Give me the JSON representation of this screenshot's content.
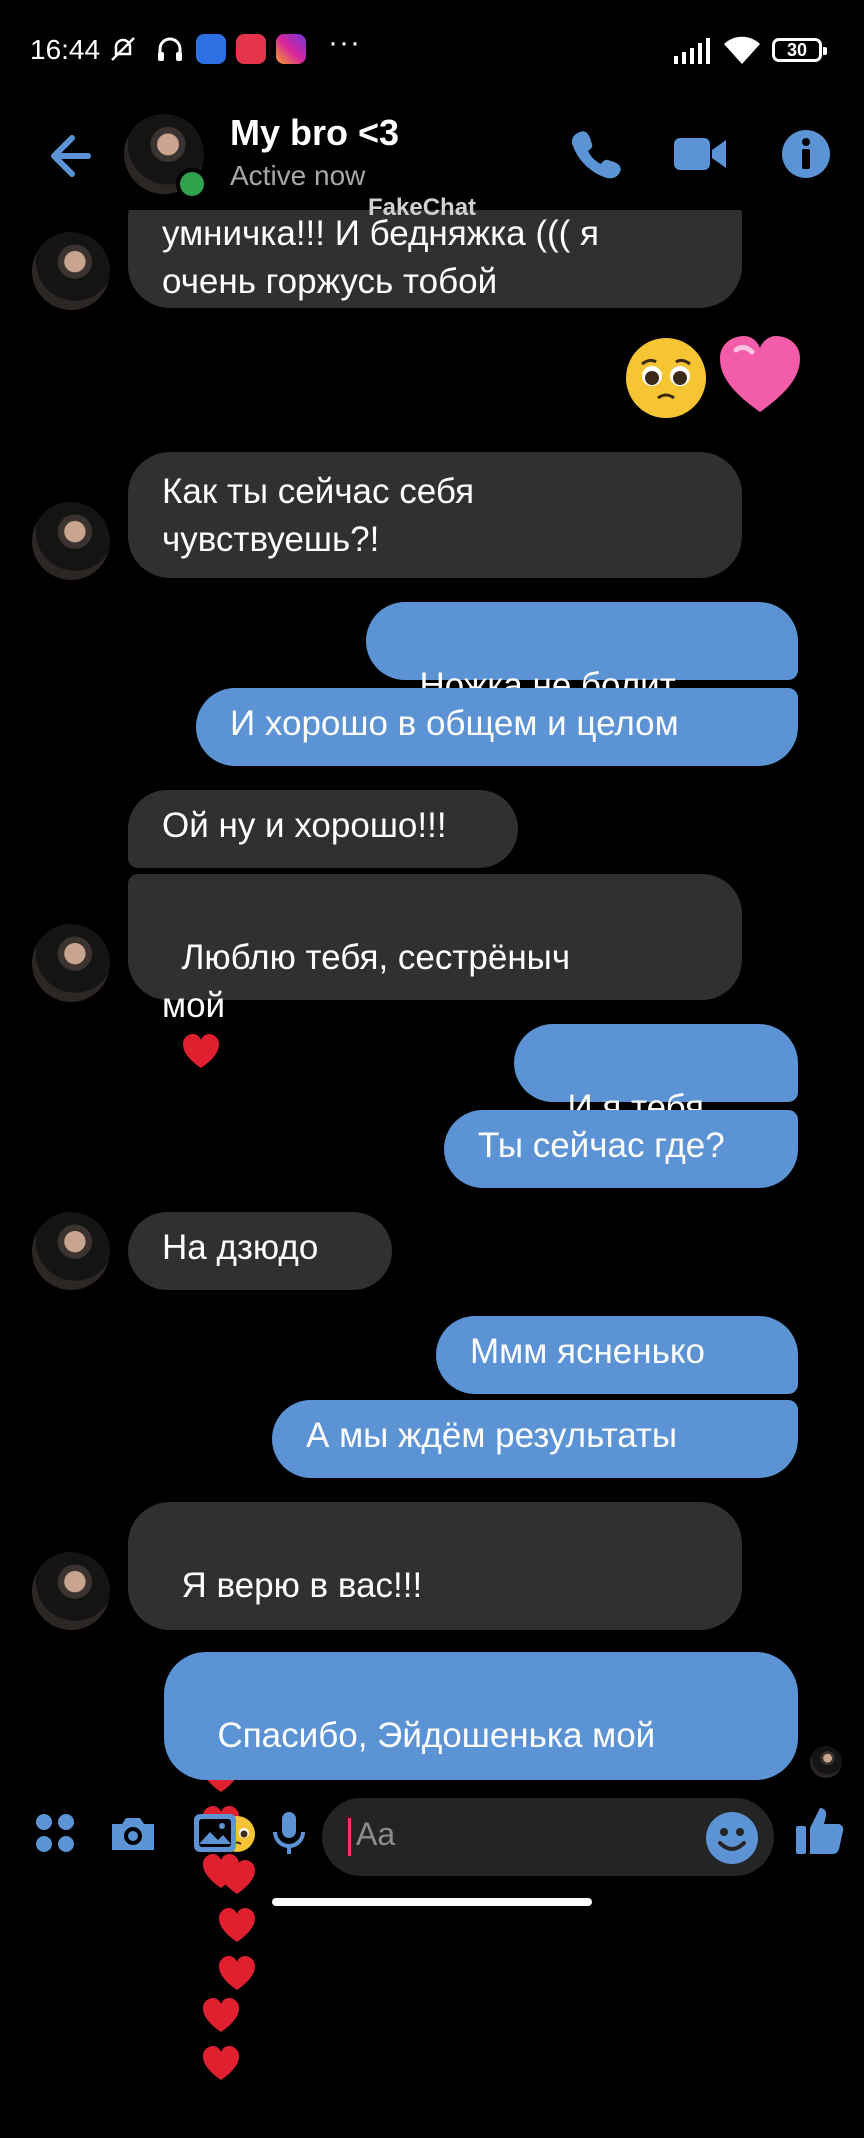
{
  "status": {
    "time": "16:44",
    "battery": "30",
    "dots": "···"
  },
  "header": {
    "title": "My bro <3",
    "subtitle": "Active now",
    "watermark": "FakeChat"
  },
  "messages": [
    {
      "side": "in",
      "text": "умничка!!! И бедняжка ((( я\nочень горжусь тобой"
    },
    {
      "side": "in",
      "text": "Как ты сейчас себя\nчувствуешь?!"
    },
    {
      "side": "out",
      "text": "Ножка не болит"
    },
    {
      "side": "out",
      "text": "И хорошо в общем и целом"
    },
    {
      "side": "in",
      "text": "Ой ну и хорошо!!!"
    },
    {
      "side": "in",
      "text": "Люблю тебя, сестрёныч\nмой"
    },
    {
      "side": "out",
      "text": "И я тебя"
    },
    {
      "side": "out",
      "text": "Ты сейчас где?"
    },
    {
      "side": "in",
      "text": "На дзюдо"
    },
    {
      "side": "out",
      "text": "Ммм ясненько"
    },
    {
      "side": "out",
      "text": "А мы ждём результаты"
    },
    {
      "side": "in",
      "text": "Я верю в вас!!!"
    },
    {
      "side": "out",
      "text": "Спасибо, Эйдошенька мой"
    }
  ],
  "composer": {
    "placeholder": "Aa"
  },
  "colors": {
    "accent": "#5b93d4",
    "incoming": "#303030",
    "online": "#31a24c",
    "heart": "#e0202e"
  },
  "icons": [
    "back-arrow-icon",
    "phone-icon",
    "video-icon",
    "info-icon",
    "apps-icon",
    "camera-icon",
    "gallery-icon",
    "microphone-icon",
    "emoji-icon",
    "like-icon"
  ]
}
